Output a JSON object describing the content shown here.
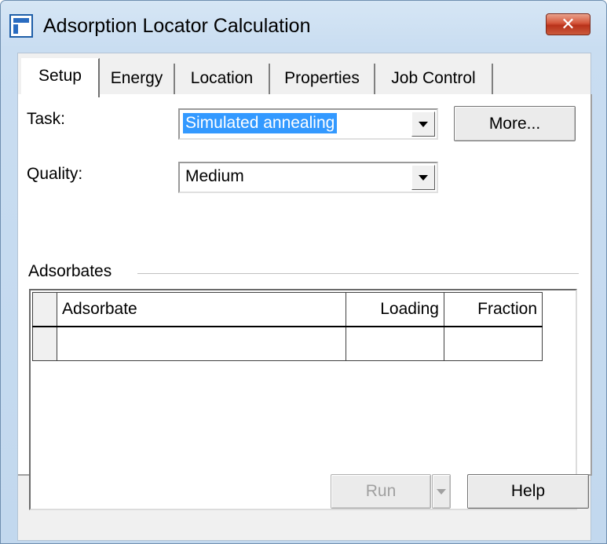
{
  "window": {
    "title": "Adsorption Locator Calculation",
    "close_label": "✕"
  },
  "tabs": [
    "Setup",
    "Energy",
    "Location",
    "Properties",
    "Job Control"
  ],
  "setup": {
    "task_label": "Task:",
    "task_value": "Simulated annealing",
    "more_label": "More...",
    "quality_label": "Quality:",
    "quality_value": "Medium",
    "adsorbates_label": "Adsorbates"
  },
  "table": {
    "columns": [
      "Adsorbate",
      "Loading",
      "Fraction"
    ],
    "rows": [
      [
        "",
        "",
        ""
      ]
    ]
  },
  "buttons": {
    "run": "Run",
    "help": "Help"
  },
  "icons": {
    "app": "app-window-icon",
    "dropdown": "chevron-down-icon"
  }
}
